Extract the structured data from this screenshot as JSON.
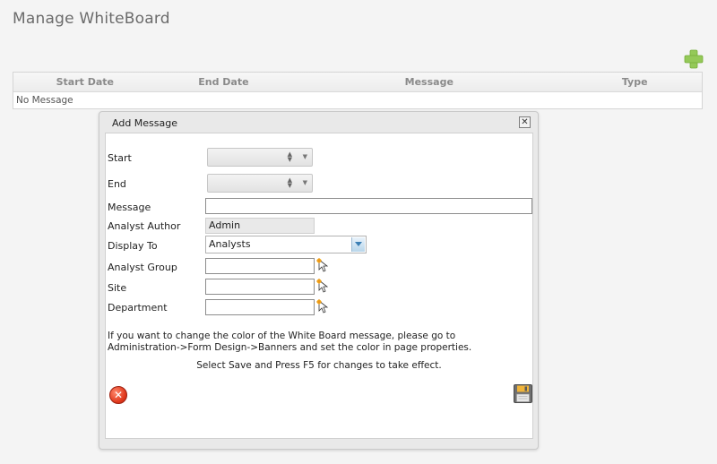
{
  "page": {
    "title": "Manage WhiteBoard"
  },
  "grid": {
    "columns": [
      "Start Date",
      "End Date",
      "Message",
      "Type"
    ],
    "empty_text": "No Message"
  },
  "dialog": {
    "title": "Add Message",
    "close_glyph": "✕",
    "fields": {
      "start_label": "Start",
      "end_label": "End",
      "message_label": "Message",
      "message_value": "",
      "author_label": "Analyst Author",
      "author_value": "Admin",
      "display_label": "Display To",
      "display_value": "Analysts",
      "group_label": "Analyst Group",
      "site_label": "Site",
      "department_label": "Department"
    },
    "info_line1": "If you want to change the color of the White Board message, please go to",
    "info_line2": "Administration->Form Design->Banners and set the color in page properties.",
    "info_line3": "Select Save and Press F5 for changes to take effect.",
    "cancel_glyph": "✕"
  },
  "colors": {
    "accent_green": "#8bc53f",
    "cancel_red": "#e0371b"
  },
  "icons": [
    "add-icon",
    "close-icon",
    "spin-icon",
    "dropdown-icon",
    "picker-icon",
    "cancel-icon",
    "save-icon"
  ]
}
